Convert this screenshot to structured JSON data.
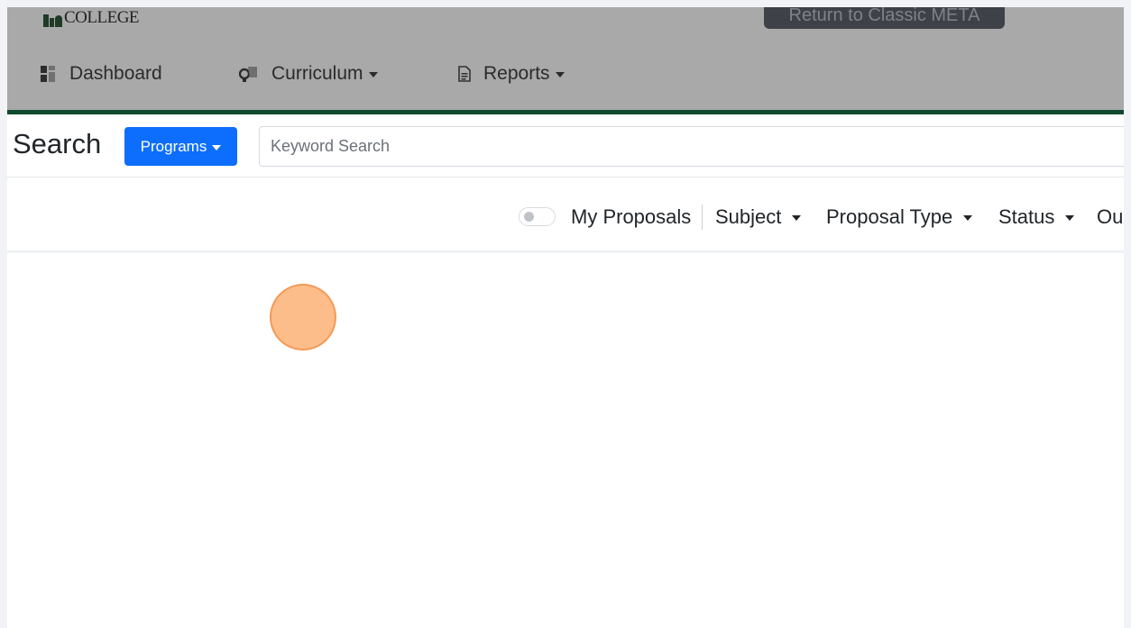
{
  "header": {
    "logo_text": "COLLEGE",
    "classic_button_label": "Return to Classic META"
  },
  "nav": {
    "dashboard_label": "Dashboard",
    "curriculum_label": "Curriculum",
    "reports_label": "Reports"
  },
  "search": {
    "label": "Search",
    "category_button_label": "Programs",
    "keyword_placeholder": "Keyword Search",
    "keyword_value": ""
  },
  "filters": {
    "my_proposals_label": "My Proposals",
    "my_proposals_on": false,
    "subject_label": "Subject",
    "proposal_type_label": "Proposal Type",
    "status_label": "Status",
    "overflow_label": "Ou"
  },
  "colors": {
    "primary": "#0d6efd",
    "header_accent": "#0f4a2e",
    "click_marker": "#fbb175"
  },
  "icons": {
    "dashboard": "dashboard-icon",
    "curriculum": "curriculum-icon",
    "reports": "reports-document-icon"
  }
}
